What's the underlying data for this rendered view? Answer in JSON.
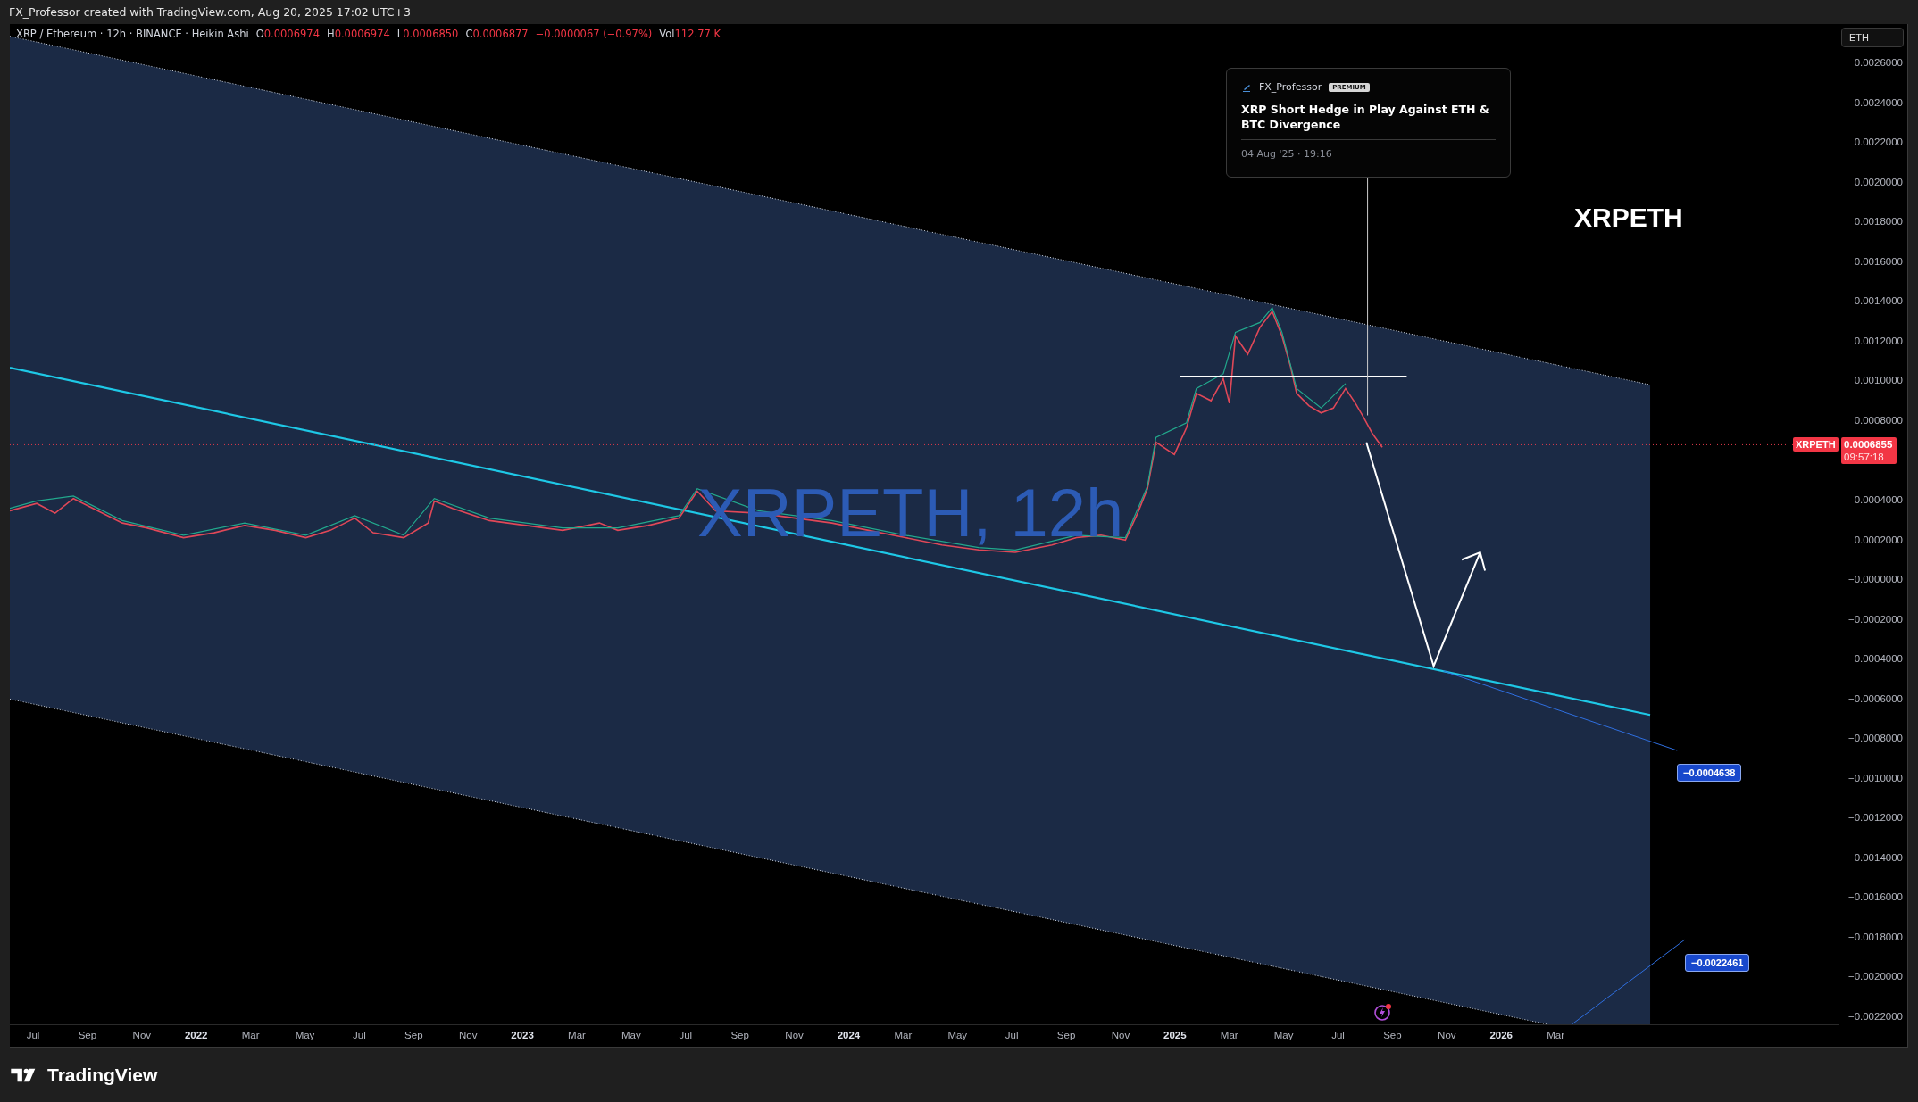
{
  "header": {
    "text": "FX_Professor created with TradingView.com, Aug 20, 2025 17:02 UTC+3"
  },
  "legend": {
    "symbol": "XRP / Ethereum · 12h · BINANCE · Heikin Ashi",
    "values": [
      {
        "label": "O",
        "value": "0.0006974"
      },
      {
        "label": "H",
        "value": "0.0006974"
      },
      {
        "label": "L",
        "value": "0.0006850"
      },
      {
        "label": "C",
        "value": "0.0006877"
      }
    ],
    "change": "−0.0000067 (−0.97%)",
    "volume": {
      "label": "Vol",
      "value": "112.77 K"
    }
  },
  "currency_button": "ETH",
  "price_axis": [
    "0.0026000",
    "0.0024000",
    "0.0022000",
    "0.0020000",
    "0.0018000",
    "0.0016000",
    "0.0014000",
    "0.0012000",
    "0.0010000",
    "0.0008000",
    "0.0004000",
    "0.0002000",
    "−0.0000000",
    "−0.0002000",
    "−0.0004000",
    "−0.0006000",
    "−0.0008000",
    "−0.0010000",
    "−0.0012000",
    "−0.0014000",
    "−0.0016000",
    "−0.0018000",
    "−0.0020000",
    "−0.0022000"
  ],
  "time_axis": [
    {
      "label": "Jul",
      "kind": "month"
    },
    {
      "label": "Sep",
      "kind": "month"
    },
    {
      "label": "Nov",
      "kind": "month"
    },
    {
      "label": "2022",
      "kind": "year"
    },
    {
      "label": "Mar",
      "kind": "month"
    },
    {
      "label": "May",
      "kind": "month"
    },
    {
      "label": "Jul",
      "kind": "month"
    },
    {
      "label": "Sep",
      "kind": "month"
    },
    {
      "label": "Nov",
      "kind": "month"
    },
    {
      "label": "2023",
      "kind": "year"
    },
    {
      "label": "Mar",
      "kind": "month"
    },
    {
      "label": "May",
      "kind": "month"
    },
    {
      "label": "Jul",
      "kind": "month"
    },
    {
      "label": "Sep",
      "kind": "month"
    },
    {
      "label": "Nov",
      "kind": "month"
    },
    {
      "label": "2024",
      "kind": "year"
    },
    {
      "label": "Mar",
      "kind": "month"
    },
    {
      "label": "May",
      "kind": "month"
    },
    {
      "label": "Jul",
      "kind": "month"
    },
    {
      "label": "Sep",
      "kind": "month"
    },
    {
      "label": "Nov",
      "kind": "month"
    },
    {
      "label": "2025",
      "kind": "year"
    },
    {
      "label": "Mar",
      "kind": "month"
    },
    {
      "label": "May",
      "kind": "month"
    },
    {
      "label": "Jul",
      "kind": "month"
    },
    {
      "label": "Sep",
      "kind": "month"
    },
    {
      "label": "Nov",
      "kind": "month"
    },
    {
      "label": "2026",
      "kind": "year"
    },
    {
      "label": "Mar",
      "kind": "month"
    }
  ],
  "watermark": "XRPETH, 12h",
  "symbol_title": "XRPETH",
  "idea_card": {
    "author": "FX_Professor",
    "badge": "PREMIUM",
    "title": "XRP Short Hedge in Play Against ETH & BTC Divergence",
    "date": "04 Aug '25 · 19:16"
  },
  "last_price": {
    "symbol": "XRPETH",
    "price": "0.0006855",
    "countdown": "09:57:18"
  },
  "line_labels": [
    "−0.0004638",
    "−0.0022461"
  ],
  "footer": {
    "logo": "TradingView"
  }
}
